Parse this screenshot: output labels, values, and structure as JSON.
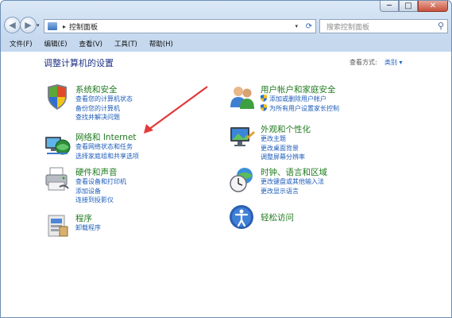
{
  "window": {
    "controls": {
      "minimize": "─",
      "maximize": "□",
      "close": "✕"
    }
  },
  "nav": {
    "back_glyph": "◀",
    "forward_glyph": "▶",
    "dropdown_glyph": "▾",
    "address_separator": "▸",
    "address_path": "控制面板",
    "address_dropdown_glyph": "▾",
    "refresh_glyph": "⟳",
    "search_placeholder": "搜索控制面板",
    "search_icon_glyph": "⚲"
  },
  "menubar": {
    "items": [
      "文件(F)",
      "编辑(E)",
      "查看(V)",
      "工具(T)",
      "帮助(H)"
    ]
  },
  "content": {
    "heading": "调整计算机的设置",
    "view_by_label": "查看方式:",
    "view_by_value": "类别 ▾"
  },
  "categories": {
    "left": [
      {
        "title": "系统和安全",
        "icon": "shield-flag-icon",
        "links": [
          "查看您的计算机状态",
          "备份您的计算机",
          "查找并解决问题"
        ]
      },
      {
        "title": "网络和 Internet",
        "icon": "network-globe-icon",
        "links": [
          "查看网络状态和任务",
          "选择家庭组和共享选项"
        ]
      },
      {
        "title": "硬件和声音",
        "icon": "printer-icon",
        "links": [
          "查看设备和打印机",
          "添加设备",
          "连接到投影仪"
        ]
      },
      {
        "title": "程序",
        "icon": "programs-icon",
        "links": [
          "卸载程序"
        ]
      }
    ],
    "right": [
      {
        "title": "用户帐户和家庭安全",
        "icon": "users-icon",
        "links": [
          "添加或删除用户帐户",
          "为所有用户设置家长控制"
        ]
      },
      {
        "title": "外观和个性化",
        "icon": "monitor-icon",
        "links": [
          "更改主题",
          "更改桌面背景",
          "调整屏幕分辨率"
        ]
      },
      {
        "title": "时钟、语言和区域",
        "icon": "clock-globe-icon",
        "links": [
          "更改键盘或其他输入法",
          "更改显示语言"
        ]
      },
      {
        "title": "轻松访问",
        "icon": "ease-of-access-icon",
        "links": []
      }
    ]
  },
  "colors": {
    "heading": "#1e3287",
    "category_title": "#1f7a1f",
    "link": "#1d5cba",
    "annotation_arrow": "#e23a3a"
  }
}
